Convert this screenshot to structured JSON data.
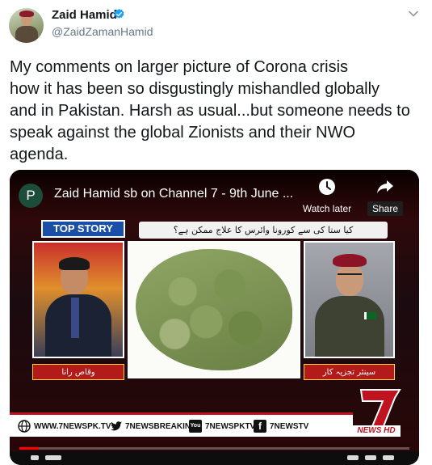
{
  "user": {
    "name": "Zaid Hamid",
    "handle": "@ZaidZamanHamid",
    "verified": true
  },
  "tweet": {
    "text": "My comments on larger picture of Corona crisis\nhow it has been so disgustingly mishandled globally\nand in Pakistan. Harsh as usual...but someone needs to\nspeak against the global Zionists and their NWO\nagenda."
  },
  "video": {
    "channel_initial": "P",
    "title": "Zaid Hamid sb on Channel 7 - 9th June ...",
    "watch_later_label": "Watch later",
    "share_label": "Share",
    "progress_fraction": 0.05,
    "overlay": {
      "top_story": "TOP STORY",
      "urdu_headline": "کیا ستا کی سے کورونا وائرس کا علاج ممکن ہے؟",
      "left_name": "وقاص رانا",
      "right_name": "سینئر تجزیہ کار",
      "brand_number": "7",
      "brand_tag": "NEWS HD",
      "ticker": {
        "website": "WWW.7NEWSPK.TV",
        "twitter": "7NEWSBREAKING",
        "youtube": "7NEWSPKTV",
        "facebook": "7NEWSTV",
        "youtube_icon_text": "You"
      }
    }
  },
  "colors": {
    "verified_blue": "#1da1f2",
    "text_dark": "#14171a",
    "text_gray": "#657786",
    "news_red": "#c1121f",
    "top_story_blue": "#1a4fa8"
  }
}
